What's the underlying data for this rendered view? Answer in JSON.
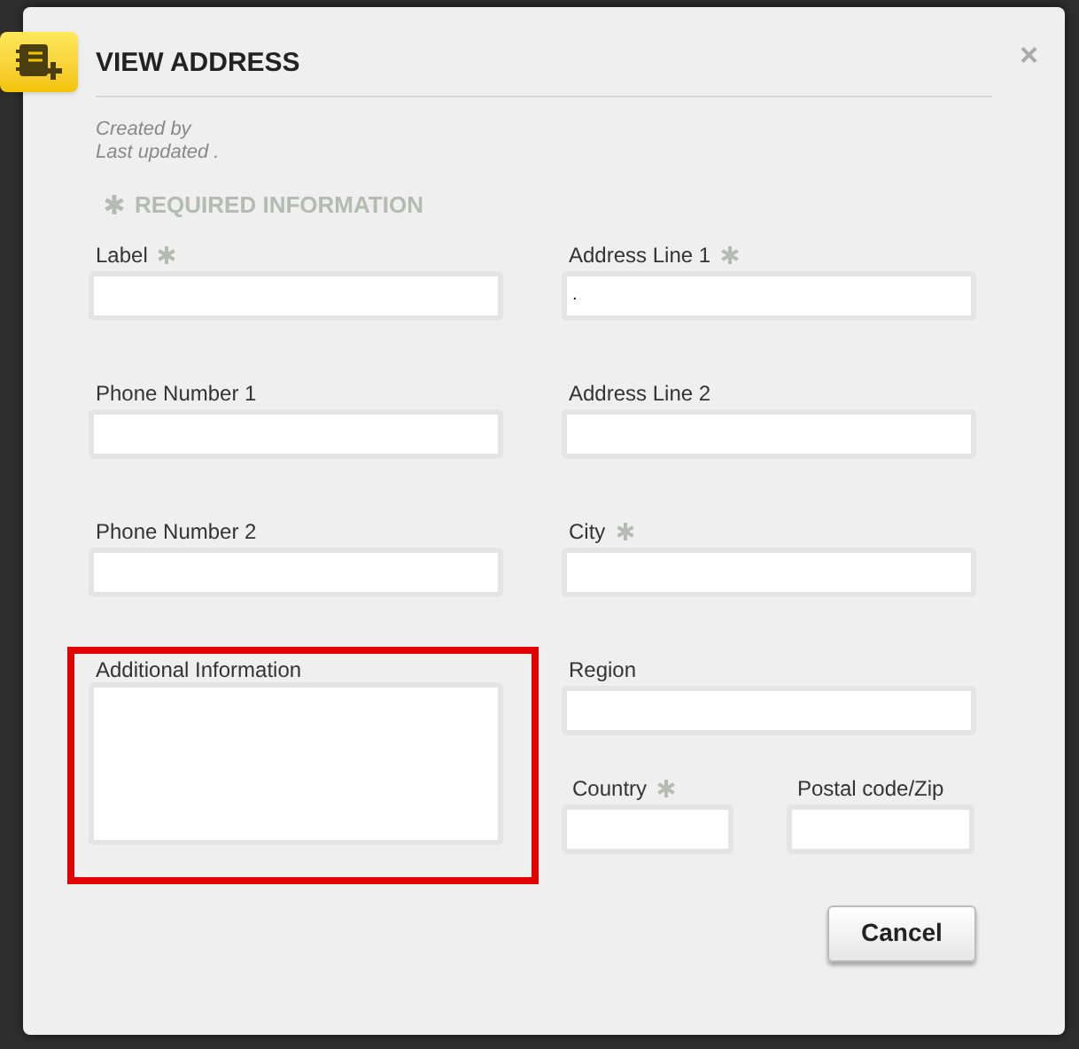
{
  "dialog": {
    "title": "VIEW ADDRESS",
    "close": "×",
    "meta": [
      "Created by",
      "Last updated ."
    ],
    "required_note": "REQUIRED INFORMATION",
    "left_fields": [
      {
        "label": "Label",
        "required": true,
        "kind": "input"
      },
      {
        "label": "Phone Number 1",
        "required": false,
        "kind": "input"
      },
      {
        "label": "Phone Number 2",
        "required": false,
        "kind": "input"
      },
      {
        "label": "Additional Information",
        "required": false,
        "kind": "textarea"
      }
    ],
    "right_fields": [
      {
        "label": "Address Line 1",
        "required": true,
        "kind": "input",
        "value": "."
      },
      {
        "label": "Address Line 2",
        "required": false,
        "kind": "input"
      },
      {
        "label": "City",
        "required": true,
        "kind": "input"
      },
      {
        "label": "Region",
        "required": false,
        "kind": "input"
      }
    ],
    "bottom_pair": [
      {
        "label": "Country",
        "required": true,
        "kind": "input"
      },
      {
        "label": "Postal code/Zip",
        "required": false,
        "kind": "input"
      }
    ],
    "buttons": [
      "Cancel"
    ]
  }
}
